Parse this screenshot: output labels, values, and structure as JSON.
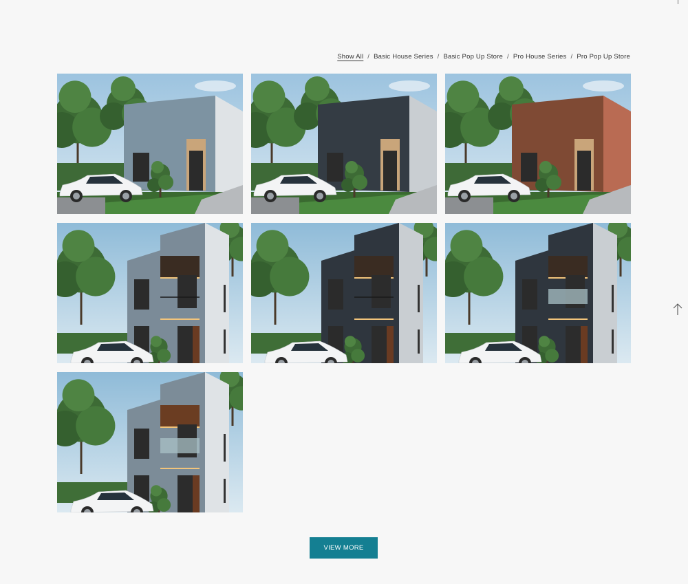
{
  "filters": [
    {
      "label": "Show All",
      "active": true
    },
    {
      "label": "Basic House Series",
      "active": false
    },
    {
      "label": "Basic Pop Up Store",
      "active": false
    },
    {
      "label": "Pro House Series",
      "active": false
    },
    {
      "label": "Pro Pop Up Store",
      "active": false
    }
  ],
  "filter_separator": "/",
  "gallery": [
    {
      "model": "single",
      "facade": "#7d93a2",
      "side": "#dfe3e6",
      "icon": "house-render-image"
    },
    {
      "model": "single",
      "facade": "#343c44",
      "side": "#c9ced2",
      "icon": "house-render-image"
    },
    {
      "model": "single",
      "facade": "#7f4a34",
      "side": "#b96b53",
      "icon": "house-render-image"
    },
    {
      "model": "double",
      "facade": "#7b8b98",
      "side": "#dfe3e6",
      "icon": "house-render-image"
    },
    {
      "model": "double",
      "facade": "#2f363e",
      "side": "#c9ced2",
      "icon": "house-render-image"
    },
    {
      "model": "double-glass",
      "facade": "#2f363e",
      "side": "#c9ced2",
      "icon": "house-render-image"
    },
    {
      "model": "double-wood",
      "facade": "#7c8c98",
      "side": "#dfe3e6",
      "icon": "house-render-image"
    }
  ],
  "view_more_label": "VIEW MORE",
  "colors": {
    "accent": "#147f92",
    "background": "#f7f7f7"
  },
  "scroll_icon": "arrow-up-icon"
}
